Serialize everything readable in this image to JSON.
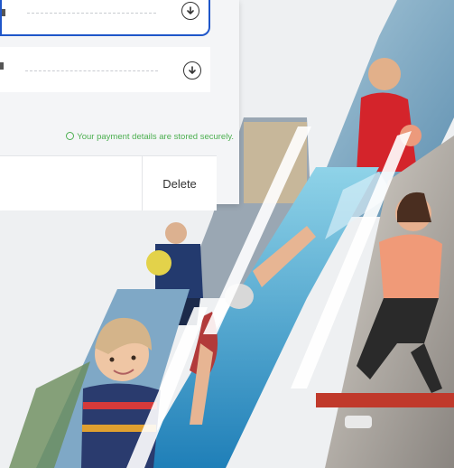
{
  "payment_card": {
    "security_note": "Your payment details are stored securely.",
    "delete_label": "Delete",
    "icons": {
      "row_action": "download-circle-icon",
      "security": "lock-shield-icon"
    }
  },
  "colors": {
    "selected_border": "#1f56c9",
    "secure_text": "#4caf50",
    "page_background": "#eef0f2"
  },
  "collage": {
    "photos": [
      "swimming-instructor-photo",
      "child-with-ball-photo",
      "swimmer-photo",
      "fitness-class-photo",
      "smiling-toddler-photo"
    ]
  }
}
